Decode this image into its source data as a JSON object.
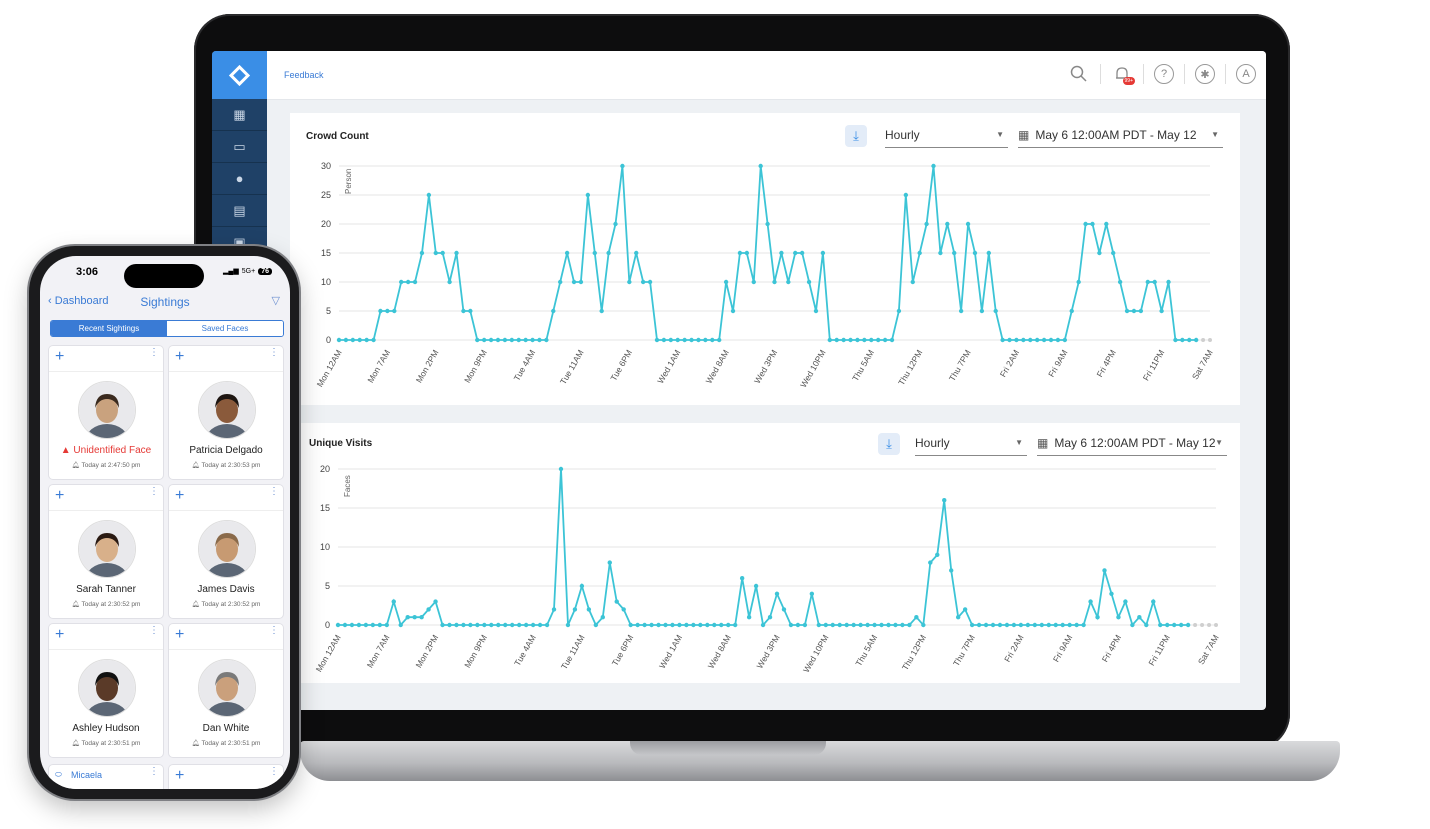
{
  "desktop": {
    "feedback_label": "Feedback",
    "notification_badge": "99+",
    "avatar_letter": "A",
    "sidebar_items": [
      "camera-grid-icon",
      "device-icon",
      "location-pin-icon",
      "map-icon",
      "scan-icon"
    ],
    "panels": [
      {
        "title": "Crowd Count",
        "granularity": "Hourly",
        "date_range": "May 6 12:00AM PDT - May 12"
      },
      {
        "title": "Unique Visits",
        "granularity": "Hourly",
        "date_range": "May 6 12:00AM PDT - May 12"
      }
    ]
  },
  "chart_data": [
    {
      "type": "line",
      "title": "Crowd Count",
      "ylabel": "Person",
      "ylim": [
        0,
        30
      ],
      "yticks": [
        0,
        5,
        10,
        15,
        20,
        25,
        30
      ],
      "xticks": [
        "Mon 12AM",
        "Mon 7AM",
        "Mon 2PM",
        "Mon 9PM",
        "Tue 4AM",
        "Tue 11AM",
        "Tue 6PM",
        "Wed 1AM",
        "Wed 8AM",
        "Wed 3PM",
        "Wed 10PM",
        "Thu 5AM",
        "Thu 12PM",
        "Thu 7PM",
        "Fri 2AM",
        "Fri 9AM",
        "Fri 4PM",
        "Fri 11PM",
        "Sat 7AM"
      ],
      "hours_per_xtick": 7,
      "grid": true,
      "series": [
        {
          "color": "#3cc4d6",
          "values": [
            0,
            0,
            0,
            0,
            0,
            0,
            5,
            5,
            5,
            10,
            10,
            10,
            15,
            25,
            15,
            15,
            10,
            15,
            5,
            5,
            0,
            0,
            0,
            0,
            0,
            0,
            0,
            0,
            0,
            0,
            0,
            5,
            10,
            15,
            10,
            10,
            25,
            15,
            5,
            15,
            20,
            30,
            10,
            15,
            10,
            10,
            0,
            0,
            0,
            0,
            0,
            0,
            0,
            0,
            0,
            0,
            10,
            5,
            15,
            15,
            10,
            30,
            20,
            10,
            15,
            10,
            15,
            15,
            10,
            5,
            15,
            0,
            0,
            0,
            0,
            0,
            0,
            0,
            0,
            0,
            0,
            5,
            25,
            10,
            15,
            20,
            30,
            15,
            20,
            15,
            5,
            20,
            15,
            5,
            15,
            5,
            0,
            0,
            0,
            0,
            0,
            0,
            0,
            0,
            0,
            0,
            5,
            10,
            20,
            20,
            15,
            20,
            15,
            10,
            5,
            5,
            5,
            10,
            10,
            5,
            10,
            0,
            0,
            0,
            0
          ]
        }
      ]
    },
    {
      "type": "line",
      "title": "Unique Visits",
      "ylabel": "Faces",
      "ylim": [
        0,
        20
      ],
      "yticks": [
        0,
        5,
        10,
        15,
        20
      ],
      "xticks": [
        "Mon 12AM",
        "Mon 7AM",
        "Mon 2PM",
        "Mon 9PM",
        "Tue 4AM",
        "Tue 11AM",
        "Tue 6PM",
        "Wed 1AM",
        "Wed 8AM",
        "Wed 3PM",
        "Wed 10PM",
        "Thu 5AM",
        "Thu 12PM",
        "Thu 7PM",
        "Fri 2AM",
        "Fri 9AM",
        "Fri 4PM",
        "Fri 11PM",
        "Sat 7AM"
      ],
      "hours_per_xtick": 7,
      "grid": true,
      "series": [
        {
          "color": "#3cc4d6",
          "values": [
            0,
            0,
            0,
            0,
            0,
            0,
            0,
            0,
            3,
            0,
            1,
            1,
            1,
            2,
            3,
            0,
            0,
            0,
            0,
            0,
            0,
            0,
            0,
            0,
            0,
            0,
            0,
            0,
            0,
            0,
            0,
            2,
            20,
            0,
            2,
            5,
            2,
            0,
            1,
            8,
            3,
            2,
            0,
            0,
            0,
            0,
            0,
            0,
            0,
            0,
            0,
            0,
            0,
            0,
            0,
            0,
            0,
            0,
            6,
            1,
            5,
            0,
            1,
            4,
            2,
            0,
            0,
            0,
            4,
            0,
            0,
            0,
            0,
            0,
            0,
            0,
            0,
            0,
            0,
            0,
            0,
            0,
            0,
            1,
            0,
            8,
            9,
            16,
            7,
            1,
            2,
            0,
            0,
            0,
            0,
            0,
            0,
            0,
            0,
            0,
            0,
            0,
            0,
            0,
            0,
            0,
            0,
            0,
            3,
            1,
            7,
            4,
            1,
            3,
            0,
            1,
            0,
            3,
            0,
            0,
            0,
            0,
            0
          ]
        }
      ]
    }
  ],
  "phone": {
    "time": "3:06",
    "signal_label": "5G+",
    "battery": "76",
    "back_label": "Dashboard",
    "title": "Sightings",
    "tabs": [
      "Recent Sightings",
      "Saved Faces"
    ],
    "cards": [
      {
        "name": "Unidentified Face",
        "time": "Today at 2:47:50 pm",
        "alert": true
      },
      {
        "name": "Patricia Delgado",
        "time": "Today at 2:30:53 pm",
        "alert": false
      },
      {
        "name": "Sarah Tanner",
        "time": "Today at 2:30:52 pm",
        "alert": false
      },
      {
        "name": "James Davis",
        "time": "Today at 2:30:52 pm",
        "alert": false
      },
      {
        "name": "Ashley Hudson",
        "time": "Today at 2:30:51 pm",
        "alert": false
      },
      {
        "name": "Dan White",
        "time": "Today at 2:30:51 pm",
        "alert": false
      }
    ],
    "partial_card_label": "Micaela"
  }
}
